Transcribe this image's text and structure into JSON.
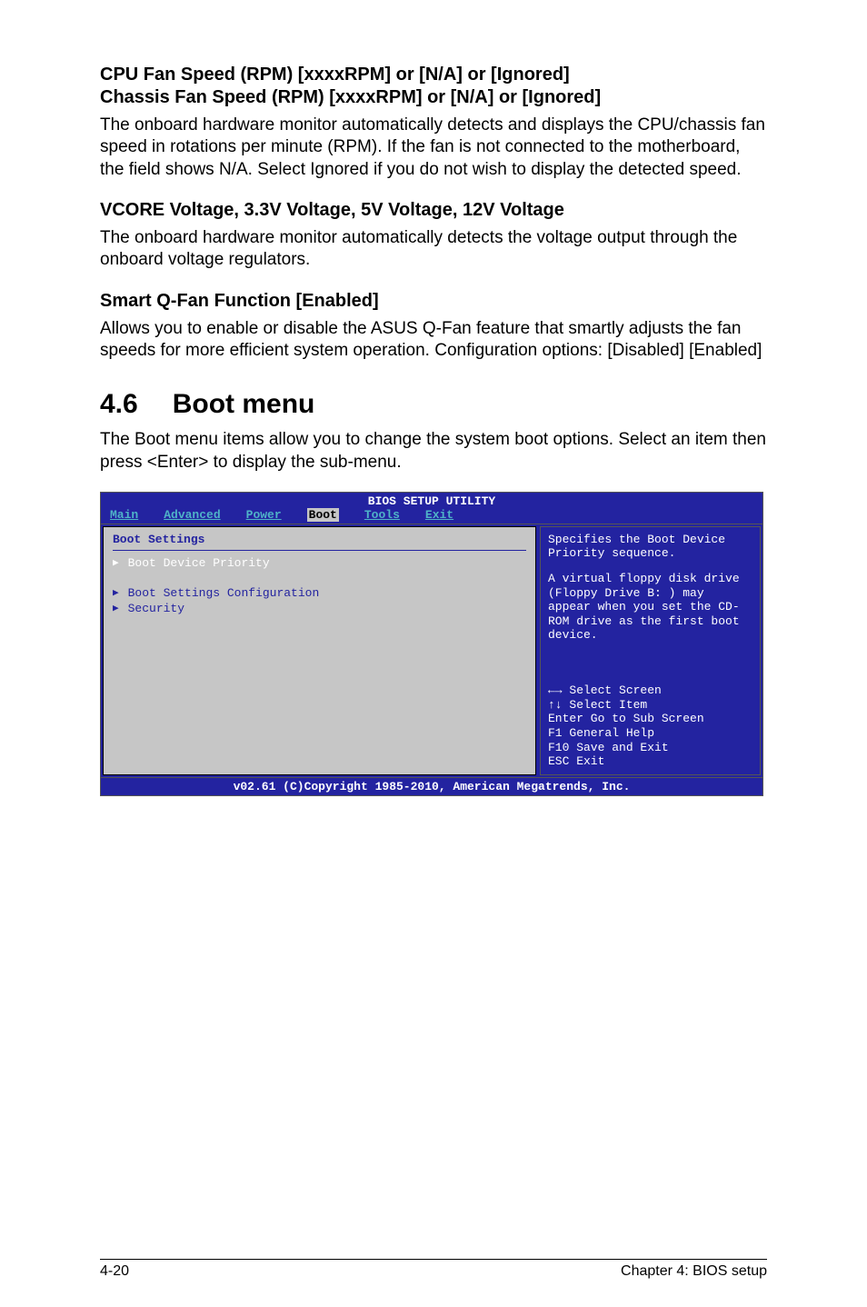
{
  "sec1": {
    "h_line1": "CPU Fan Speed (RPM) [xxxxRPM] or [N/A] or [Ignored]",
    "h_line2": "Chassis Fan Speed (RPM) [xxxxRPM] or [N/A] or [Ignored]",
    "p": "The onboard hardware monitor automatically detects and displays the CPU/chassis fan speed in rotations per minute (RPM). If the fan is not connected to the motherboard, the field shows N/A. Select Ignored if you do not wish to display the detected speed."
  },
  "sec2": {
    "h": "VCORE Voltage, 3.3V Voltage, 5V Voltage, 12V Voltage",
    "p": "The onboard hardware monitor automatically detects the voltage output through the onboard voltage regulators."
  },
  "sec3": {
    "h": "Smart Q-Fan Function [Enabled]",
    "p": "Allows you to enable or disable the ASUS Q-Fan feature that smartly adjusts the fan speeds for more efficient system operation. Configuration options: [Disabled] [Enabled]"
  },
  "main_section": {
    "num": "4.6",
    "title": "Boot menu",
    "p": "The Boot menu items allow you to change the system boot options. Select an item then press <Enter> to display the sub-menu."
  },
  "bios": {
    "title": "BIOS SETUP UTILITY",
    "tabs": [
      "Main",
      "Advanced",
      "Power",
      "Boot",
      "Tools",
      "Exit"
    ],
    "active_tab": "Boot",
    "left_heading": "Boot Settings",
    "items": [
      {
        "label": "Boot Device Priority",
        "white": true
      },
      {
        "label": "Boot Settings Configuration",
        "white": false
      },
      {
        "label": "Security",
        "white": false
      }
    ],
    "help_desc": "Specifies the Boot Device Priority sequence.",
    "help_note": "A virtual floppy disk drive (Floppy Drive B: ) may appear when you set the CD-ROM drive as the first boot device.",
    "keys": [
      "←→   Select Screen",
      "↑↓    Select Item",
      "Enter Go to Sub Screen",
      "F1    General Help",
      "F10   Save and Exit",
      "ESC   Exit"
    ],
    "footer": "v02.61 (C)Copyright 1985-2010, American Megatrends, Inc."
  },
  "footer": {
    "left": "4-20",
    "right": "Chapter 4: BIOS setup"
  }
}
